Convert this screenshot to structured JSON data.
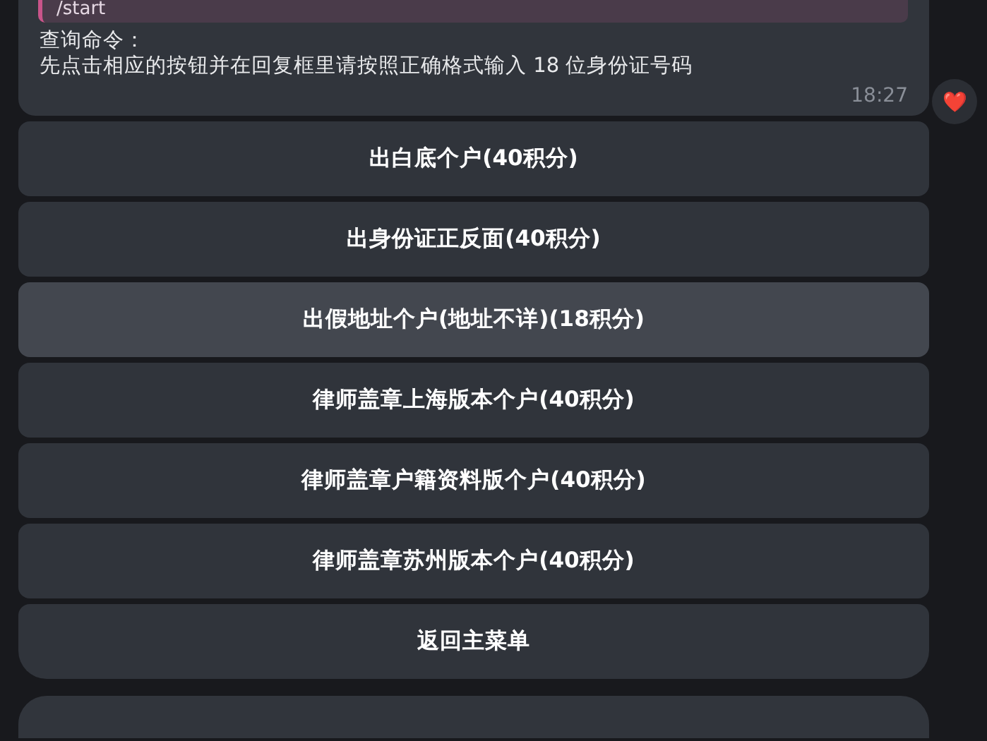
{
  "message": {
    "quote": "/start",
    "lines": [
      "查询命令：",
      "先点击相应的按钮并在回复框里请按照正确格式输入 18 位身份证号码"
    ],
    "time": "18:27",
    "reaction": "❤️"
  },
  "buttons": [
    {
      "label": "出白底个户(40积分)",
      "highlighted": false
    },
    {
      "label": "出身份证正反面(40积分)",
      "highlighted": false
    },
    {
      "label": "出假地址个户(地址不详)(18积分)",
      "highlighted": true
    },
    {
      "label": "律师盖章上海版本个户(40积分)",
      "highlighted": false
    },
    {
      "label": "律师盖章户籍资料版个户(40积分)",
      "highlighted": false
    },
    {
      "label": "律师盖章苏州版本个户(40积分)",
      "highlighted": false
    },
    {
      "label": "返回主菜单",
      "highlighted": false
    }
  ]
}
